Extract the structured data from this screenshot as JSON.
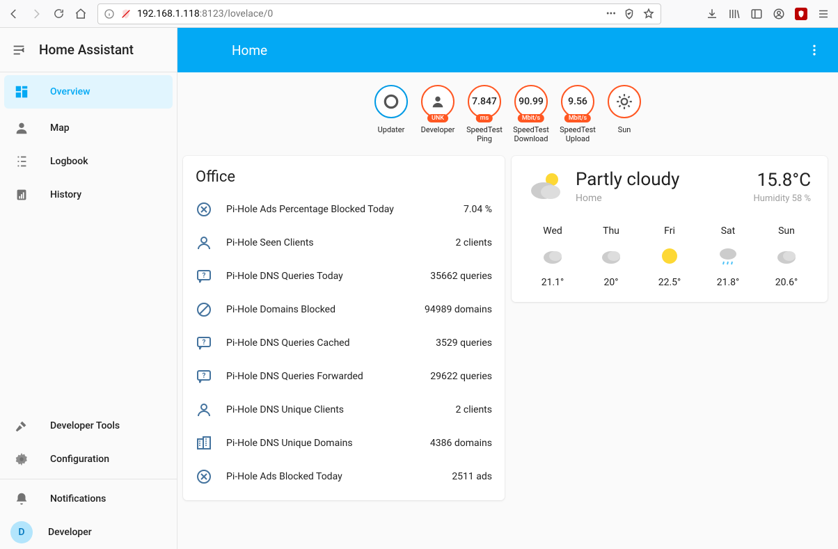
{
  "browser": {
    "url_host": "192.168.1.118",
    "url_port": ":8123",
    "url_path": "/lovelace/0"
  },
  "sidebar": {
    "app_title": "Home Assistant",
    "items": [
      {
        "label": "Overview",
        "active": true
      },
      {
        "label": "Map"
      },
      {
        "label": "Logbook"
      },
      {
        "label": "History"
      }
    ],
    "bottom_items": [
      {
        "label": "Developer Tools"
      },
      {
        "label": "Configuration"
      }
    ],
    "footer_items": [
      {
        "label": "Notifications"
      },
      {
        "label": "Developer",
        "avatar": "D"
      }
    ]
  },
  "topbar": {
    "title": "Home"
  },
  "badges": [
    {
      "value": "",
      "tag": "",
      "label": "Updater",
      "circle": "blue",
      "icon": "ring"
    },
    {
      "value": "",
      "tag": "UNK",
      "label": "Developer",
      "circle": "orange",
      "icon": "person"
    },
    {
      "value": "7.847",
      "tag": "ms",
      "label": "SpeedTest Ping",
      "circle": "orange"
    },
    {
      "value": "90.99",
      "tag": "Mbit/s",
      "label": "SpeedTest Download",
      "circle": "orange"
    },
    {
      "value": "9.56",
      "tag": "Mbit/s",
      "label": "SpeedTest Upload",
      "circle": "orange"
    },
    {
      "value": "",
      "tag": "",
      "label": "Sun",
      "circle": "orange",
      "icon": "sun"
    }
  ],
  "office": {
    "title": "Office",
    "entities": [
      {
        "icon": "close-circle",
        "name": "Pi-Hole Ads Percentage Blocked Today",
        "value": "7.04 %"
      },
      {
        "icon": "account",
        "name": "Pi-Hole Seen Clients",
        "value": "2 clients"
      },
      {
        "icon": "comment-q",
        "name": "Pi-Hole DNS Queries Today",
        "value": "35662 queries"
      },
      {
        "icon": "block",
        "name": "Pi-Hole Domains Blocked",
        "value": "94989 domains"
      },
      {
        "icon": "comment-q",
        "name": "Pi-Hole DNS Queries Cached",
        "value": "3529 queries"
      },
      {
        "icon": "comment-q",
        "name": "Pi-Hole DNS Queries Forwarded",
        "value": "29622 queries"
      },
      {
        "icon": "account",
        "name": "Pi-Hole DNS Unique Clients",
        "value": "2 clients"
      },
      {
        "icon": "domain",
        "name": "Pi-Hole DNS Unique Domains",
        "value": "4386 domains"
      },
      {
        "icon": "close-circle",
        "name": "Pi-Hole Ads Blocked Today",
        "value": "2511 ads"
      }
    ]
  },
  "weather": {
    "condition": "Partly cloudy",
    "location": "Home",
    "temp": "15.8°C",
    "humidity": "Humidity 58 %",
    "forecast": [
      {
        "day": "Wed",
        "icon": "cloudy",
        "temp": "21.1°"
      },
      {
        "day": "Thu",
        "icon": "cloudy",
        "temp": "20°"
      },
      {
        "day": "Fri",
        "icon": "sunny",
        "temp": "22.5°"
      },
      {
        "day": "Sat",
        "icon": "rainy",
        "temp": "21.8°"
      },
      {
        "day": "Sun",
        "icon": "cloudy",
        "temp": "20.6°"
      }
    ]
  }
}
